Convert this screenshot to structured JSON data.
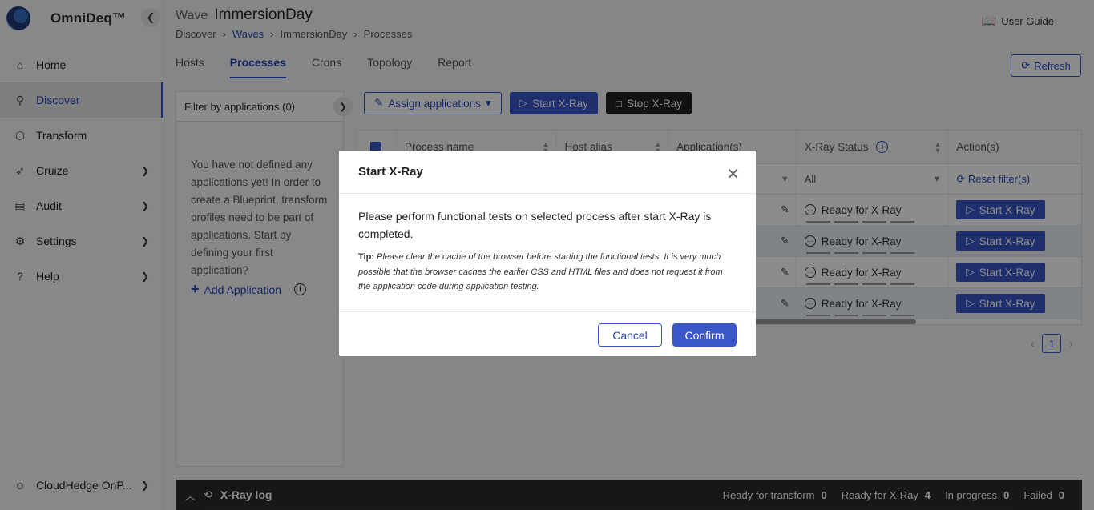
{
  "brand": {
    "name": "OmniDeq™"
  },
  "sidebar": {
    "items": [
      {
        "label": "Home",
        "icon": "home-icon",
        "glyph": "⌂",
        "has_children": false
      },
      {
        "label": "Discover",
        "icon": "discover-icon",
        "glyph": "⚲",
        "has_children": false,
        "active": true
      },
      {
        "label": "Transform",
        "icon": "cube-icon",
        "glyph": "⬡",
        "has_children": false
      },
      {
        "label": "Cruize",
        "icon": "rocket-icon",
        "glyph": "➶",
        "has_children": true
      },
      {
        "label": "Audit",
        "icon": "audit-icon",
        "glyph": "▤",
        "has_children": true
      },
      {
        "label": "Settings",
        "icon": "gear-icon",
        "glyph": "⚙",
        "has_children": true
      },
      {
        "label": "Help",
        "icon": "help-icon",
        "glyph": "?",
        "has_children": true
      }
    ],
    "account": {
      "label": "CloudHedge OnP...",
      "icon": "user-icon"
    }
  },
  "header": {
    "title_prefix": "Wave",
    "title": "ImmersionDay",
    "breadcrumb": [
      "Discover",
      "Waves",
      "ImmersionDay",
      "Processes"
    ],
    "user_guide": "User Guide"
  },
  "tabs": [
    "Hosts",
    "Processes",
    "Crons",
    "Topology",
    "Report"
  ],
  "active_tab": "Processes",
  "refresh_label": "Refresh",
  "filter_panel": {
    "title": "Filter by applications (0)",
    "empty_message": "You have not defined any applications yet! In order to create a Blueprint, transform profiles need to be part of applications. Start by defining your first application?",
    "add_label": "Add Application"
  },
  "toolbar": {
    "assign_label": "Assign applications",
    "start_label": "Start X-Ray",
    "stop_label": "Stop X-Ray"
  },
  "table": {
    "columns": [
      "Process name",
      "Host alias",
      "Application(s)",
      "X-Ray Status",
      "Action(s)"
    ],
    "status_filter": "All",
    "reset_label": "Reset filter(s)",
    "rows": [
      {
        "status": "Ready for X-Ray",
        "action": "Start X-Ray"
      },
      {
        "status": "Ready for X-Ray",
        "action": "Start X-Ray"
      },
      {
        "status": "Ready for X-Ray",
        "action": "Start X-Ray"
      },
      {
        "status": "Ready for X-Ray",
        "action": "Start X-Ray"
      }
    ]
  },
  "pagination": {
    "current_page": "1"
  },
  "xray_log": {
    "title": "X-Ray log",
    "stats": [
      {
        "label": "Ready for transform",
        "value": "0"
      },
      {
        "label": "Ready for X-Ray",
        "value": "4"
      },
      {
        "label": "In progress",
        "value": "0"
      },
      {
        "label": "Failed",
        "value": "0"
      }
    ]
  },
  "modal": {
    "title": "Start X-Ray",
    "message": "Please perform functional tests on selected process after start X-Ray is completed.",
    "tip_label": "Tip:",
    "tip_text": "Please clear the cache of the browser before starting the functional tests. It is very much possible that the browser caches the earlier CSS and HTML files and does not request it from the application code during application testing.",
    "cancel_label": "Cancel",
    "confirm_label": "Confirm"
  },
  "colors": {
    "accent": "#3a56c8",
    "dark": "#2b2b2b",
    "row_highlight": "#e9f1f8"
  }
}
